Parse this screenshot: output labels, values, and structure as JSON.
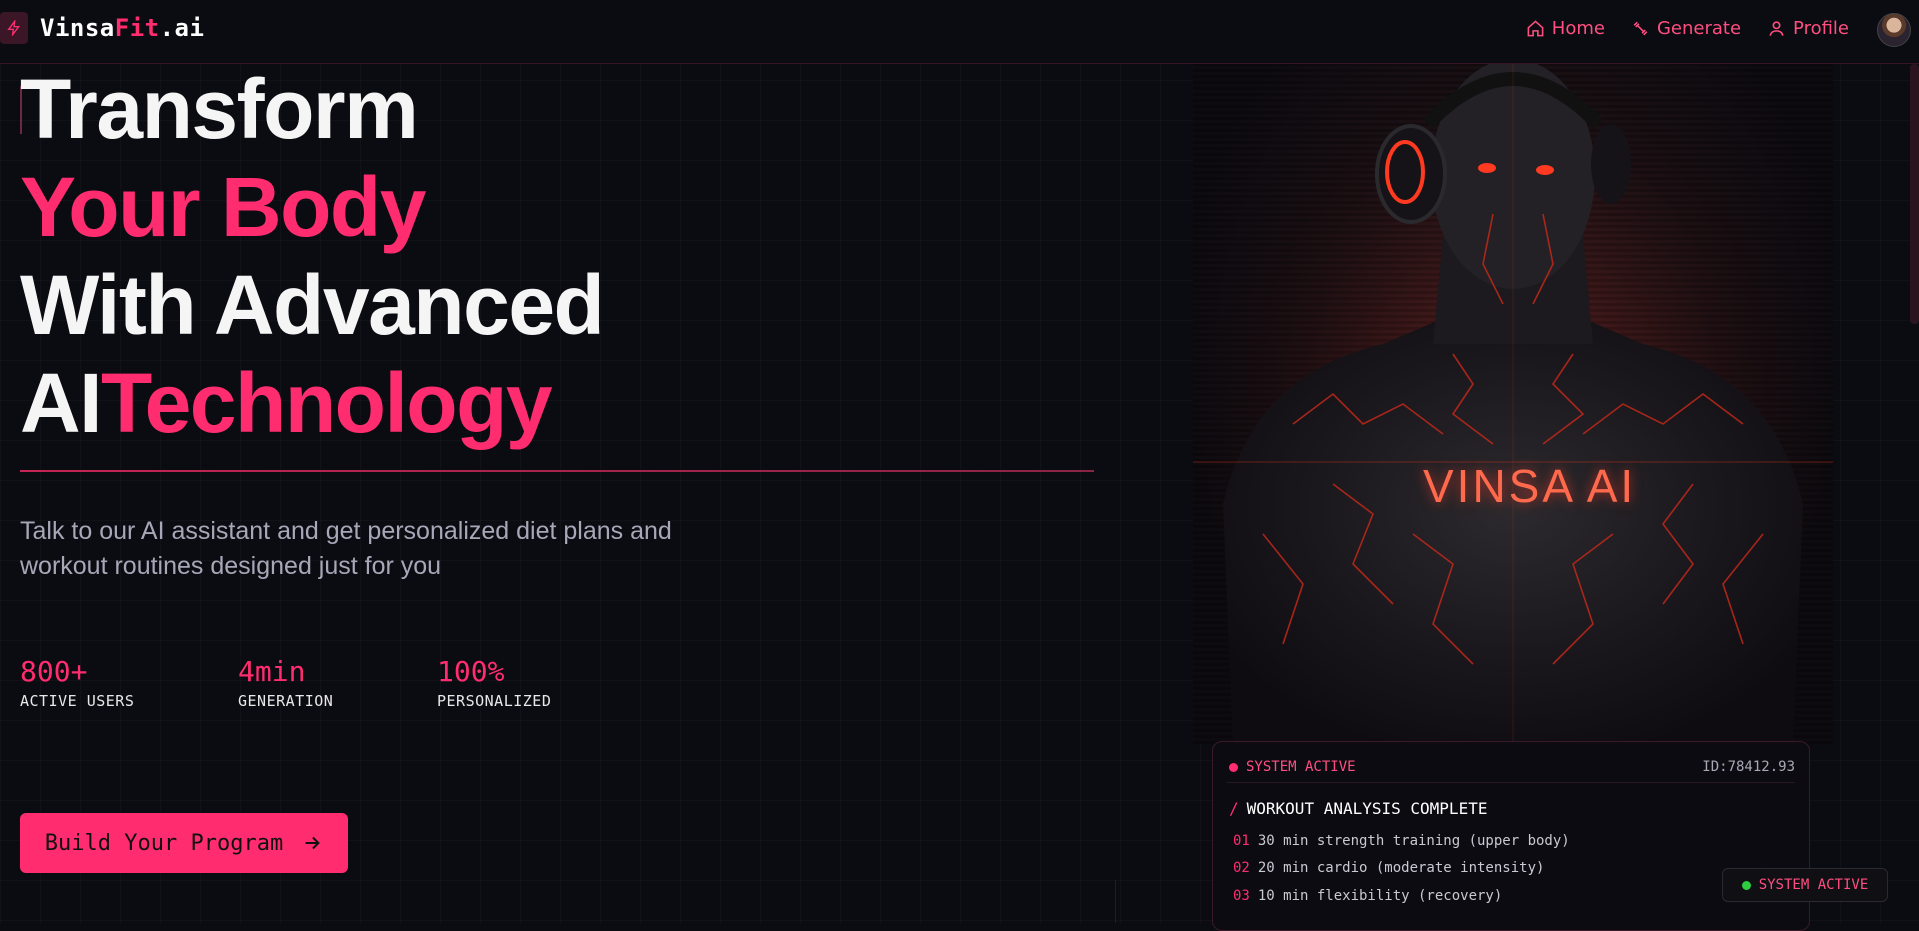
{
  "nav": {
    "brand_part1": "Vinsa",
    "brand_part2": "Fit",
    "brand_part3": ".ai",
    "links": [
      {
        "label": "Home",
        "icon": "home-icon"
      },
      {
        "label": "Generate",
        "icon": "dumbbell-icon"
      },
      {
        "label": "Profile",
        "icon": "user-icon"
      }
    ]
  },
  "hero": {
    "line1": "Transform",
    "line2": "Your Body",
    "line3": "With Advanced",
    "line4_a": "AI",
    "line4_b": "Technology",
    "subtitle": "Talk to our AI assistant and get personalized diet plans and workout routines designed just for you",
    "cta_label": "Build Your Program"
  },
  "stats": [
    {
      "value": "800+",
      "label": "ACTIVE USERS"
    },
    {
      "value": "4min",
      "label": "GENERATION"
    },
    {
      "value": "100%",
      "label": "PERSONALIZED"
    }
  ],
  "image": {
    "chest_text": "VINSA AI"
  },
  "card": {
    "status": "SYSTEM ACTIVE",
    "id": "ID:78412.93",
    "title": "WORKOUT ANALYSIS COMPLETE",
    "items": [
      {
        "num": "01",
        "text": "30 min strength training (upper body)"
      },
      {
        "num": "02",
        "text": "20 min cardio (moderate intensity)"
      },
      {
        "num": "03",
        "text": "10 min flexibility (recovery)"
      }
    ]
  },
  "badge": {
    "label": "SYSTEM ACTIVE"
  },
  "colors": {
    "accent": "#ff2d6f",
    "background": "#0b0b12",
    "status_green": "#2ecc40"
  }
}
